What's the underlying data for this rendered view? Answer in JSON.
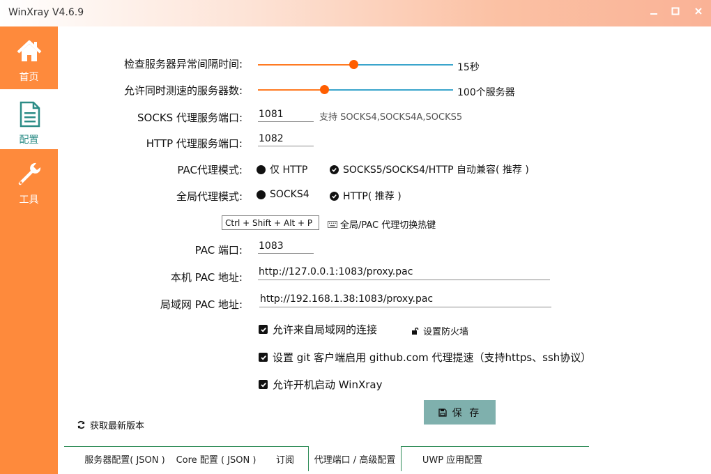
{
  "window": {
    "title": "WinXray V4.6.9"
  },
  "sidebar": {
    "items": [
      {
        "label": "首页",
        "icon": "home-icon"
      },
      {
        "label": "配置",
        "icon": "document-icon"
      },
      {
        "label": "工具",
        "icon": "wrench-icon"
      }
    ],
    "active_index": 1
  },
  "settings": {
    "check_interval": {
      "label": "检查服务器异常间隔时间:",
      "value_text": "15秒",
      "fraction": 0.49
    },
    "concurrent": {
      "label": "允许同时测速的服务器数:",
      "value_text": "100个服务器",
      "fraction": 0.34
    },
    "socks_port": {
      "label": "SOCKS 代理服务端口:",
      "value": "1081",
      "hint": "支持 SOCKS4,SOCKS4A,SOCKS5"
    },
    "http_port": {
      "label": "HTTP  代理服务端口:",
      "value": "1082"
    },
    "pac_mode": {
      "label": "PAC代理模式:",
      "option1": "仅 HTTP",
      "option2": "SOCKS5/SOCKS4/HTTP 自动兼容( 推荐 )",
      "selected": 2
    },
    "global_mode": {
      "label": "全局代理模式:",
      "option1": "SOCKS4",
      "option2": "HTTP( 推荐 )",
      "selected": 2
    },
    "hotkey": {
      "value": "Ctrl + Shift + Alt + P",
      "label": "全局/PAC 代理切换热键"
    },
    "pac_port": {
      "label": "PAC 端口:",
      "value": "1083"
    },
    "local_pac": {
      "label": "本机 PAC 地址:",
      "value": "http://127.0.0.1:1083/proxy.pac"
    },
    "lan_pac": {
      "label": "局域网 PAC 地址:",
      "value": "http://192.168.1.38:1083/proxy.pac"
    },
    "allow_lan": {
      "label": "允许来自局域网的连接",
      "checked": true,
      "firewall_label": "设置防火墙"
    },
    "git_proxy": {
      "label": "设置 git 客户端启用 github.com 代理提速（支持https、ssh协议）",
      "checked": true
    },
    "autostart": {
      "label": "允许开机启动 WinXray",
      "checked": true
    }
  },
  "actions": {
    "save_label": "保 存",
    "update_label": "获取最新版本"
  },
  "tabs": [
    {
      "label": "服务器配置( JSON )"
    },
    {
      "label": "Core 配置 ( JSON )"
    },
    {
      "label": "订阅"
    },
    {
      "label": "代理端口 / 高级配置"
    },
    {
      "label": "UWP 应用配置"
    }
  ],
  "active_tab": 3,
  "colors": {
    "sidebar": "#fe8a3c",
    "accent": "#ff5e00",
    "slider_rest": "#3aa5cc",
    "save_button": "#7fb0ad",
    "tab_border": "#2e8b57"
  }
}
